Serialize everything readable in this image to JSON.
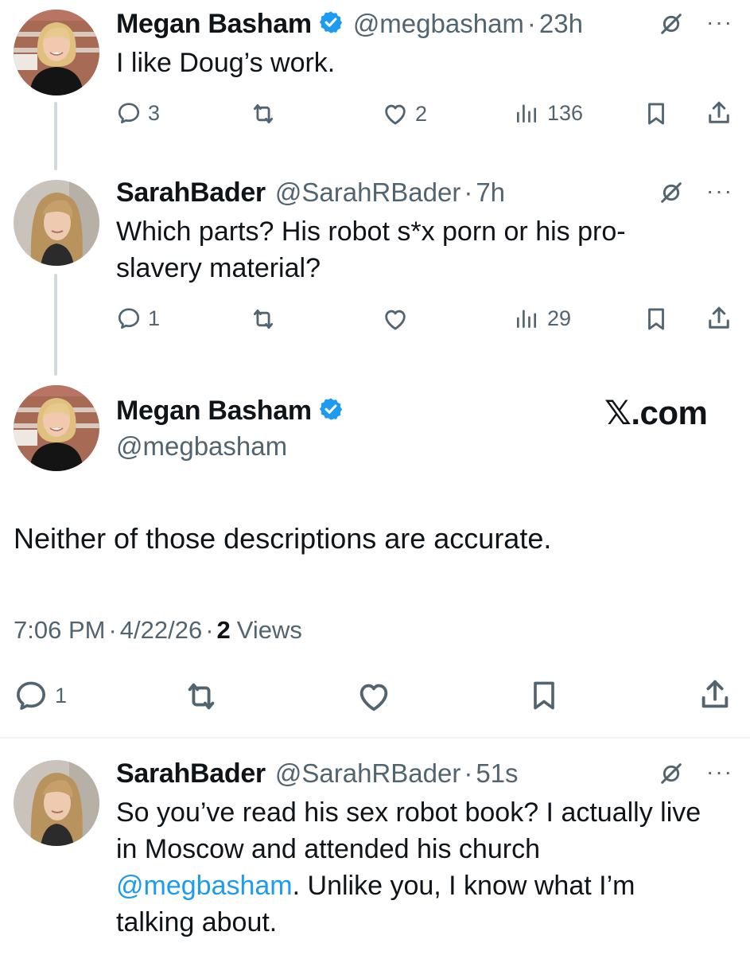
{
  "tweets": [
    {
      "name": "Megan Basham",
      "handle": "@megbasham",
      "sep": "·",
      "time": "23h",
      "text": "I like Doug’s work.",
      "metrics": {
        "replies": "3",
        "likes": "2",
        "views": "136"
      }
    },
    {
      "name": "SarahBader",
      "handle": "@SarahRBader",
      "sep": "·",
      "time": "7h",
      "text_line1": "Which parts? His robot s*x porn or his pro-",
      "text_line2": "slavery material?",
      "metrics": {
        "replies": "1",
        "views": "29"
      }
    }
  ],
  "focused": {
    "name": "Megan Basham",
    "handle": "@megbasham",
    "watermark": "𝕏.com",
    "text": "Neither of those descriptions are accurate.",
    "time": "7:06 PM",
    "sep1": "·",
    "date": "4/22/26",
    "sep2": "·",
    "views_count": "2",
    "views_label": "Views",
    "metrics": {
      "replies": "1"
    }
  },
  "reply": {
    "name": "SarahBader",
    "handle": "@SarahRBader",
    "sep": "·",
    "time": "51s",
    "line1": "So you’ve read his sex robot book? I actually live",
    "line2": "in Moscow and attended his church",
    "mention": "@megbasham",
    "line3_rest": ". Unlike you, I know what I’m",
    "line4": "talking about."
  },
  "icons": {
    "verified": "verified-badge-icon",
    "grok": "grok-icon",
    "more": "more-icon",
    "reply": "reply-icon",
    "retweet": "retweet-icon",
    "like": "like-icon",
    "views": "views-icon",
    "bookmark": "bookmark-icon",
    "share": "share-icon"
  },
  "colors": {
    "accent": "#1d9bf0",
    "text": "#0f1419",
    "muted": "#536471",
    "line": "#cfd9de",
    "divider": "#eff3f4"
  }
}
